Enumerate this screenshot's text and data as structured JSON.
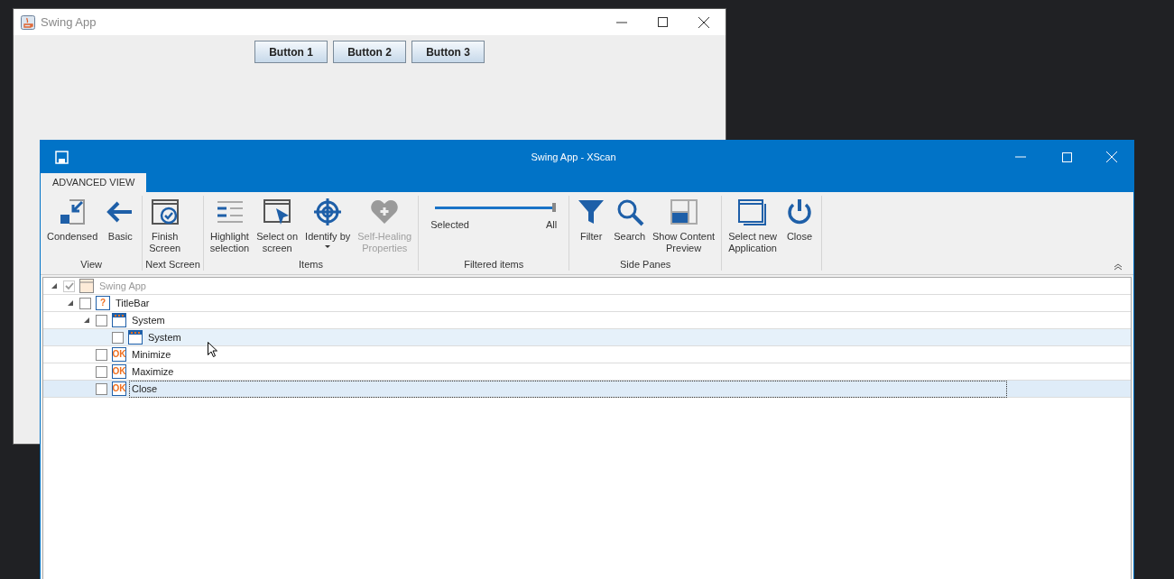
{
  "back_window": {
    "title": "Swing App",
    "buttons": [
      "Button 1",
      "Button 2",
      "Button 3"
    ]
  },
  "front_window": {
    "title": "Swing App - XScan"
  },
  "tabs": [
    {
      "label": "ADVANCED VIEW",
      "selected": true
    }
  ],
  "ribbon_groups": [
    {
      "label": "View",
      "items": [
        {
          "kind": "condensed",
          "label": "Condensed",
          "disabled": false
        },
        {
          "kind": "back",
          "label": "Basic",
          "disabled": false
        }
      ]
    },
    {
      "label": "Next Screen",
      "items": [
        {
          "kind": "finish",
          "label": "Finish\nScreen",
          "disabled": false
        }
      ]
    },
    {
      "label": "Items",
      "items": [
        {
          "kind": "highlight",
          "label": "Highlight\nselection",
          "disabled": false
        },
        {
          "kind": "select",
          "label": "Select on\nscreen",
          "disabled": false
        },
        {
          "kind": "identify",
          "label": "Identify by",
          "dropdown": true,
          "disabled": false
        },
        {
          "kind": "heal",
          "label": "Self-Healing\nProperties",
          "disabled": true
        }
      ]
    },
    {
      "label": "Filtered items",
      "slider": {
        "level": 1,
        "min_label": "Selected",
        "max_label": "All"
      }
    },
    {
      "label": "Side Panes",
      "items": [
        {
          "kind": "filter",
          "label": "Filter",
          "disabled": false
        },
        {
          "kind": "search",
          "label": "Search",
          "disabled": false
        },
        {
          "kind": "preview",
          "label": "Show Content\nPreview",
          "disabled": false
        }
      ]
    },
    {
      "items": [
        {
          "kind": "newapp",
          "label": "Select new\nApplication",
          "disabled": false
        },
        {
          "kind": "power",
          "label": "Close",
          "disabled": false
        }
      ]
    }
  ],
  "tree": [
    {
      "label": "Swing App",
      "kind": "app",
      "checked": true,
      "disabled": true,
      "expanded": true,
      "selected": false,
      "hovered": false,
      "children": [
        {
          "label": "TitleBar",
          "kind": "unknown",
          "badge": "?",
          "checked": false,
          "disabled": false,
          "expanded": true,
          "selected": false,
          "hovered": false,
          "children": [
            {
              "label": "System",
              "kind": "window",
              "checked": false,
              "disabled": false,
              "expanded": true,
              "selected": false,
              "hovered": false,
              "children": [
                {
                  "label": "System",
                  "kind": "window",
                  "checked": false,
                  "disabled": false,
                  "selected": false,
                  "hovered": true
                }
              ]
            },
            {
              "label": "Minimize",
              "kind": "button",
              "badge": "OK",
              "checked": false,
              "disabled": false,
              "selected": false,
              "hovered": false
            },
            {
              "label": "Maximize",
              "kind": "button",
              "badge": "OK",
              "checked": false,
              "disabled": false,
              "selected": false,
              "hovered": false
            },
            {
              "label": "Close",
              "kind": "button",
              "badge": "OK",
              "checked": false,
              "disabled": false,
              "selected": true,
              "hovered": false
            }
          ]
        }
      ]
    }
  ]
}
